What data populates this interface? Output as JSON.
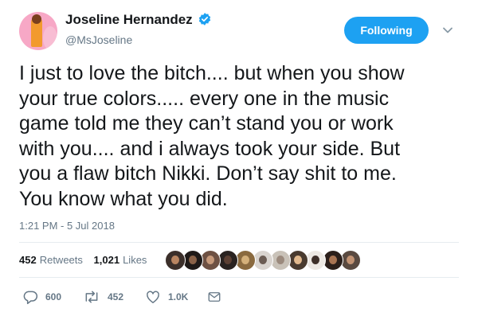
{
  "user": {
    "display_name": "Joseline Hernandez",
    "username": "@MsJoseline",
    "verified": true
  },
  "follow_button": {
    "label": "Following"
  },
  "tweet": {
    "lines": [
      "I just to love the bitch.... but when you show",
      "your true colors..... every one in the music",
      "game told me they can’t stand you or work",
      "with you.... and i always took your side. But",
      "you a flaw bitch Nikki. Don’t say shit to me.",
      "You know what you did."
    ],
    "timestamp": "1:21 PM - 5 Jul 2018"
  },
  "stats": {
    "retweets": {
      "value": "452",
      "label": "Retweets"
    },
    "likes": {
      "value": "1,021",
      "label": "Likes"
    }
  },
  "liker_avatars": [
    {
      "bg": "#3b2f2a",
      "face": "#b98561"
    },
    {
      "bg": "#1f1a18",
      "face": "#8a6248"
    },
    {
      "bg": "#6e5143",
      "face": "#c79a7b"
    },
    {
      "bg": "#2a2321",
      "face": "#5c4034"
    },
    {
      "bg": "#8a6a3f",
      "face": "#d4b07a"
    },
    {
      "bg": "#d9d4cf",
      "face": "#6b5c53"
    },
    {
      "bg": "#c9c2b8",
      "face": "#9b8a7d"
    },
    {
      "bg": "#4a3b30",
      "face": "#e2b98e"
    },
    {
      "bg": "#ece8e3",
      "face": "#3d2f29"
    },
    {
      "bg": "#2b1f1a",
      "face": "#a87452"
    },
    {
      "bg": "#5a4a40",
      "face": "#c29373"
    }
  ],
  "actions": {
    "reply": {
      "icon": "reply-icon",
      "count": "600"
    },
    "retweet": {
      "icon": "retweet-icon",
      "count": "452"
    },
    "like": {
      "icon": "heart-icon",
      "count": "1.0K"
    },
    "message": {
      "icon": "envelope-icon",
      "count": ""
    }
  },
  "colors": {
    "accent": "#1da1f2",
    "secondary_text": "#657786",
    "primary_text": "#14171a",
    "divider": "#e6ecf0"
  }
}
